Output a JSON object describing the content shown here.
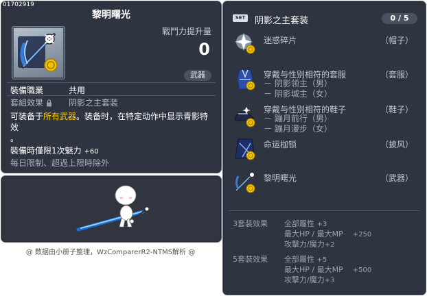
{
  "item": {
    "id": "01702919",
    "name": "黎明曙光",
    "boost_label": "戰鬥力提升量",
    "boost_value": "0",
    "category_badge": "武器",
    "job_label": "裝備職業",
    "job_value": "共用",
    "set_effect_label": "套組效果",
    "set_effect_value": "阴影之主套装",
    "desc_line1_prefix": "可装备于",
    "desc_line1_highlight": "所有武器",
    "desc_line1_suffix": "。装备时，在特定动作中显示青影特效",
    "desc_line2": "。",
    "charm_text": "裝備時僅限1次魅力",
    "charm_value": "+60",
    "limit_text": "每日限制、超過上限時除外"
  },
  "set": {
    "badge": "SET",
    "title": "阴影之主套装",
    "count": "0 / 5",
    "pieces": [
      {
        "name": "迷惑碎片",
        "category": "（帽子）",
        "subs": []
      },
      {
        "name": "穿戴与性别相符的套服",
        "category": "（套服）",
        "subs": [
          "－ 阴影领主（男）",
          "－ 阴影城主（女）"
        ]
      },
      {
        "name": "穿戴与性别相符的鞋子",
        "category": "（鞋子）",
        "subs": [
          "－ 蹦月前行（男）",
          "－ 蹦月漫步（女）"
        ]
      },
      {
        "name": "命运枷锁",
        "category": "（披风）",
        "subs": []
      },
      {
        "name": "黎明曙光",
        "category": "（武器）",
        "subs": []
      }
    ],
    "bonuses": [
      {
        "label": "3套装效果",
        "stats": [
          {
            "name": "全部屬性",
            "value": "+3"
          },
          {
            "name": "最大HP / 最大MP",
            "value": "+250"
          },
          {
            "name": "攻擊力/魔力",
            "value": "+2"
          }
        ]
      },
      {
        "label": "5套装效果",
        "stats": [
          {
            "name": "全部屬性",
            "value": "+5"
          },
          {
            "name": "最大HP / 最大MP",
            "value": "+500"
          },
          {
            "name": "攻擊力/魔力",
            "value": "+3"
          }
        ]
      }
    ]
  },
  "footer": "@ 数据由小册子整理，WzComparerR2-NTMS解析 @",
  "colors": {
    "panel_bg": "#2e3440",
    "highlight": "#ffcc00",
    "coin": "#f2c200"
  },
  "icons": {
    "item_icon": "weapon-scythe-icon",
    "coin": "gold-coin-icon",
    "lock": "lock-icon"
  }
}
